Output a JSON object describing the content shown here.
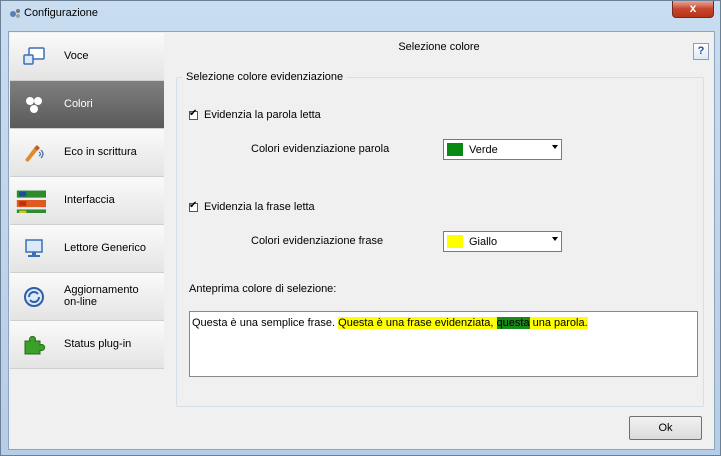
{
  "window": {
    "title": "Configurazione",
    "close_glyph": "x"
  },
  "sidebar": {
    "items": [
      {
        "label": "Voce",
        "icon": "voice-monitor-icon"
      },
      {
        "label": "Colori",
        "icon": "colors-icon",
        "active": true
      },
      {
        "label": "Eco in scrittura",
        "icon": "typing-echo-icon"
      },
      {
        "label": "Interfaccia",
        "icon": "interface-icon"
      },
      {
        "label": "Lettore Generico",
        "icon": "generic-reader-icon"
      },
      {
        "label_line1": "Aggiornamento",
        "label_line2": "on-line",
        "icon": "online-update-icon"
      },
      {
        "label": "Status plug-in",
        "icon": "puzzle-icon"
      }
    ]
  },
  "main": {
    "title": "Selezione colore",
    "help_label": "?",
    "group_title": "Selezione colore evidenziazione",
    "word_highlight": {
      "label": "Evidenzia la parola letta",
      "checked": true,
      "check_glyph": "✔"
    },
    "word_color": {
      "label": "Colori evidenziazione parola",
      "value": "Verde",
      "swatch": "#0a8a12"
    },
    "sentence_highlight": {
      "label": "Evidenzia la frase letta",
      "checked": true,
      "check_glyph": "✔"
    },
    "sentence_color": {
      "label": "Colori evidenziazione frase",
      "value": "Giallo",
      "swatch": "#ffff00"
    },
    "preview_label": "Anteprima colore di selezione:",
    "preview": {
      "plain": "Questa è una semplice frase. ",
      "sentence_before": "Questa è una frase evidenziata, ",
      "word": "questa",
      "sentence_after": " una parola."
    }
  },
  "footer": {
    "ok_label": "Ok"
  }
}
